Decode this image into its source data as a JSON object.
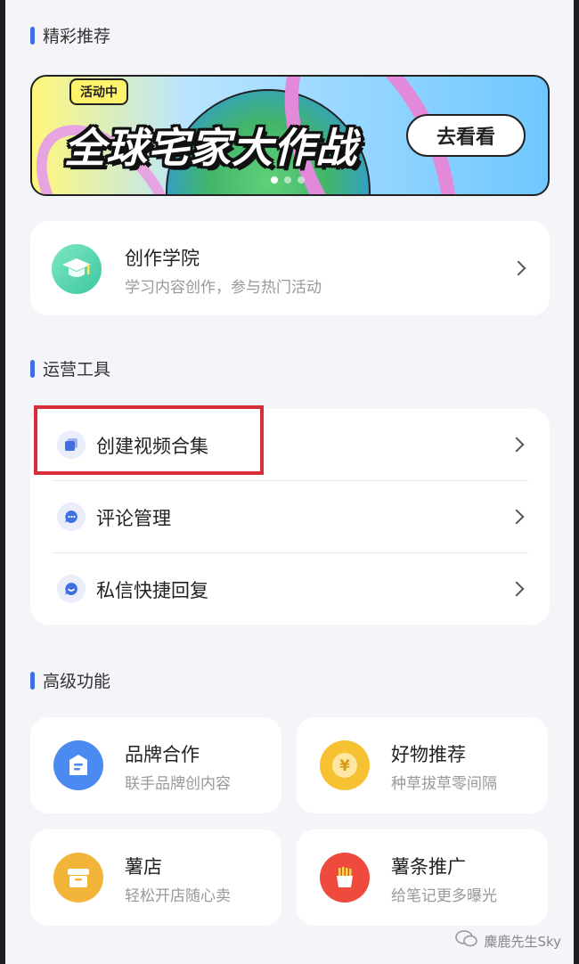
{
  "sections": {
    "featured": "精彩推荐",
    "operations": "运营工具",
    "advanced": "高级功能"
  },
  "banner": {
    "tag": "活动中",
    "headline": "全球宅家大作战",
    "cta": "去看看",
    "active_dot": 1,
    "dot_count": 3
  },
  "academy": {
    "title": "创作学院",
    "subtitle": "学习内容创作，参与热门活动"
  },
  "tools": [
    {
      "label": "创建视频合集",
      "icon": "collection-icon"
    },
    {
      "label": "评论管理",
      "icon": "comment-icon"
    },
    {
      "label": "私信快捷回复",
      "icon": "message-icon"
    }
  ],
  "features": [
    {
      "title": "品牌合作",
      "subtitle": "联手品牌创内容",
      "icon": "brand-icon",
      "color": "#4b8af0"
    },
    {
      "title": "好物推荐",
      "subtitle": "种草拔草零间隔",
      "icon": "yen-coin-icon",
      "color": "#f6c233"
    },
    {
      "title": "薯店",
      "subtitle": "轻松开店随心卖",
      "icon": "store-box-icon",
      "color": "#f3b43a"
    },
    {
      "title": "薯条推广",
      "subtitle": "给笔记更多曝光",
      "icon": "fries-icon",
      "color": "#ee4a3e"
    }
  ],
  "watermark": "麋鹿先生Sky",
  "colors": {
    "accent": "#3f6fe0",
    "highlight": "#d62f3a"
  }
}
